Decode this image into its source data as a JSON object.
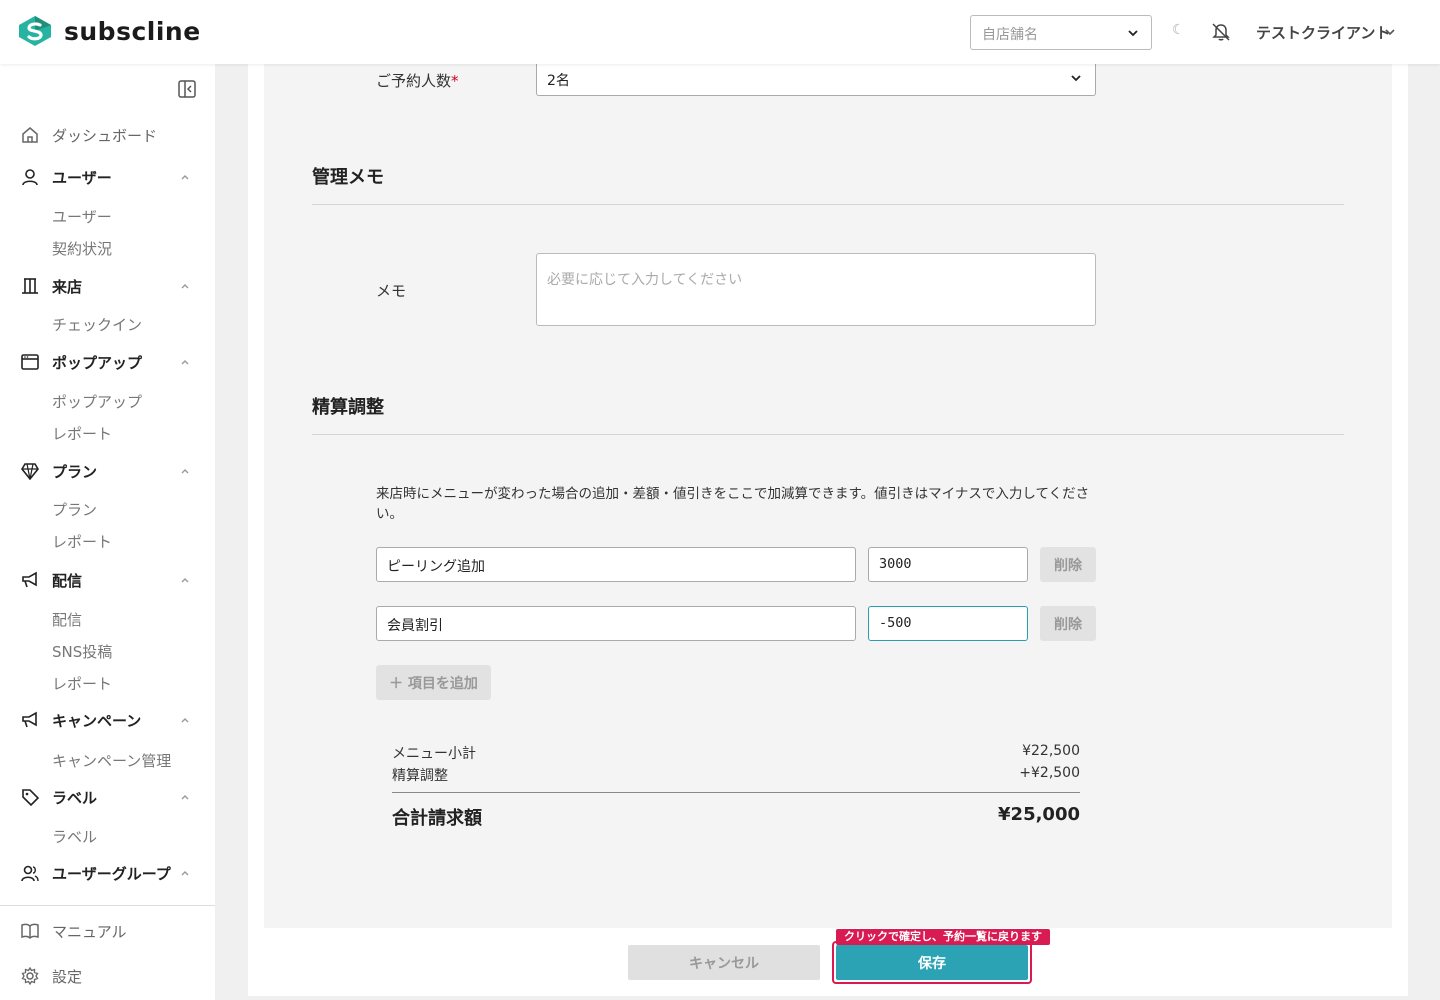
{
  "header": {
    "logo_text": "subscline",
    "store_placeholder": "自店舗名",
    "theme_glyph": "☾",
    "client_name": "テストクライアント"
  },
  "sidebar": {
    "dashboard": "ダッシュボード",
    "groups": [
      {
        "label": "ユーザー",
        "icon": "user-icon",
        "items": [
          "ユーザー",
          "契約状況"
        ]
      },
      {
        "label": "来店",
        "icon": "building-icon",
        "items": [
          "チェックイン"
        ]
      },
      {
        "label": "ポップアップ",
        "icon": "window-icon",
        "items": [
          "ポップアップ",
          "レポート"
        ]
      },
      {
        "label": "プラン",
        "icon": "diamond-icon",
        "items": [
          "プラン",
          "レポート"
        ]
      },
      {
        "label": "配信",
        "icon": "megaphone-icon",
        "items": [
          "配信",
          "SNS投稿",
          "レポート"
        ]
      },
      {
        "label": "キャンペーン",
        "icon": "megaphone-icon",
        "items": [
          "キャンペーン管理"
        ]
      },
      {
        "label": "ラベル",
        "icon": "tag-icon",
        "items": [
          "ラベル"
        ]
      },
      {
        "label": "ユーザーグループ",
        "icon": "users-icon",
        "items": []
      }
    ],
    "manual": "マニュアル",
    "settings": "設定"
  },
  "form": {
    "party_size_label": "ご予約人数",
    "required_mark": "*",
    "party_size_value": "2名",
    "admin_memo_title": "管理メモ",
    "memo_label": "メモ",
    "memo_placeholder": "必要に応じて入力してください",
    "settlement_title": "精算調整",
    "settlement_help": "来店時にメニューが変わった場合の追加・差額・値引きをここで加減算できます。値引きはマイナスで入力してください。",
    "adjustments": [
      {
        "name": "ピーリング追加",
        "amount": "3000",
        "delete_label": "削除"
      },
      {
        "name": "会員割引",
        "amount": "-500",
        "delete_label": "削除"
      }
    ],
    "add_item_label": "＋ 項目を追加",
    "summary": {
      "subtotal_label": "メニュー小計",
      "subtotal_value": "¥22,500",
      "adjust_label": "精算調整",
      "adjust_value": "+¥2,500",
      "total_label": "合計請求額",
      "total_value": "¥25,000"
    }
  },
  "actions": {
    "cancel_label": "キャンセル",
    "save_label": "保存",
    "save_tooltip": "クリックで確定し、予約一覧に戻ります"
  },
  "colors": {
    "accent": "#2ba3b4",
    "highlight": "#d81b52",
    "required": "#d0021b"
  }
}
